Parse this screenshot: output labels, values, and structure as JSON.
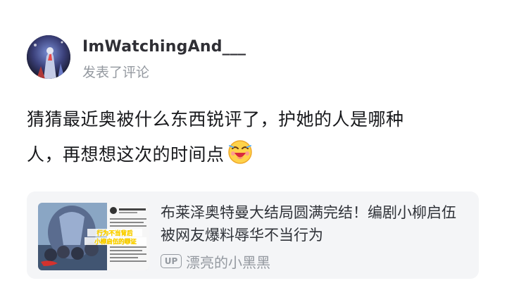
{
  "comment": {
    "username": "ImWatchingAnd___",
    "action": "发表了评论",
    "text_line1": "猜猜最近奥被什么东西锐评了，护她的人是哪种",
    "text_line2": "人，再想想这次的时间点",
    "emoji_icon": "laughing-face-emoji-icon"
  },
  "card": {
    "title": "布莱泽奥特曼大结局圆满完结！编剧小柳启伍被网友爆料辱华不当行为",
    "up_badge": "UP",
    "author": "漂亮的小黑黑",
    "thumbnail_caption_1": "行为不当背后",
    "thumbnail_caption_2": "小柳启伍的罪证"
  },
  "colors": {
    "text_primary": "#18191c",
    "text_secondary": "#9499a0",
    "card_background": "#f4f5f7"
  }
}
